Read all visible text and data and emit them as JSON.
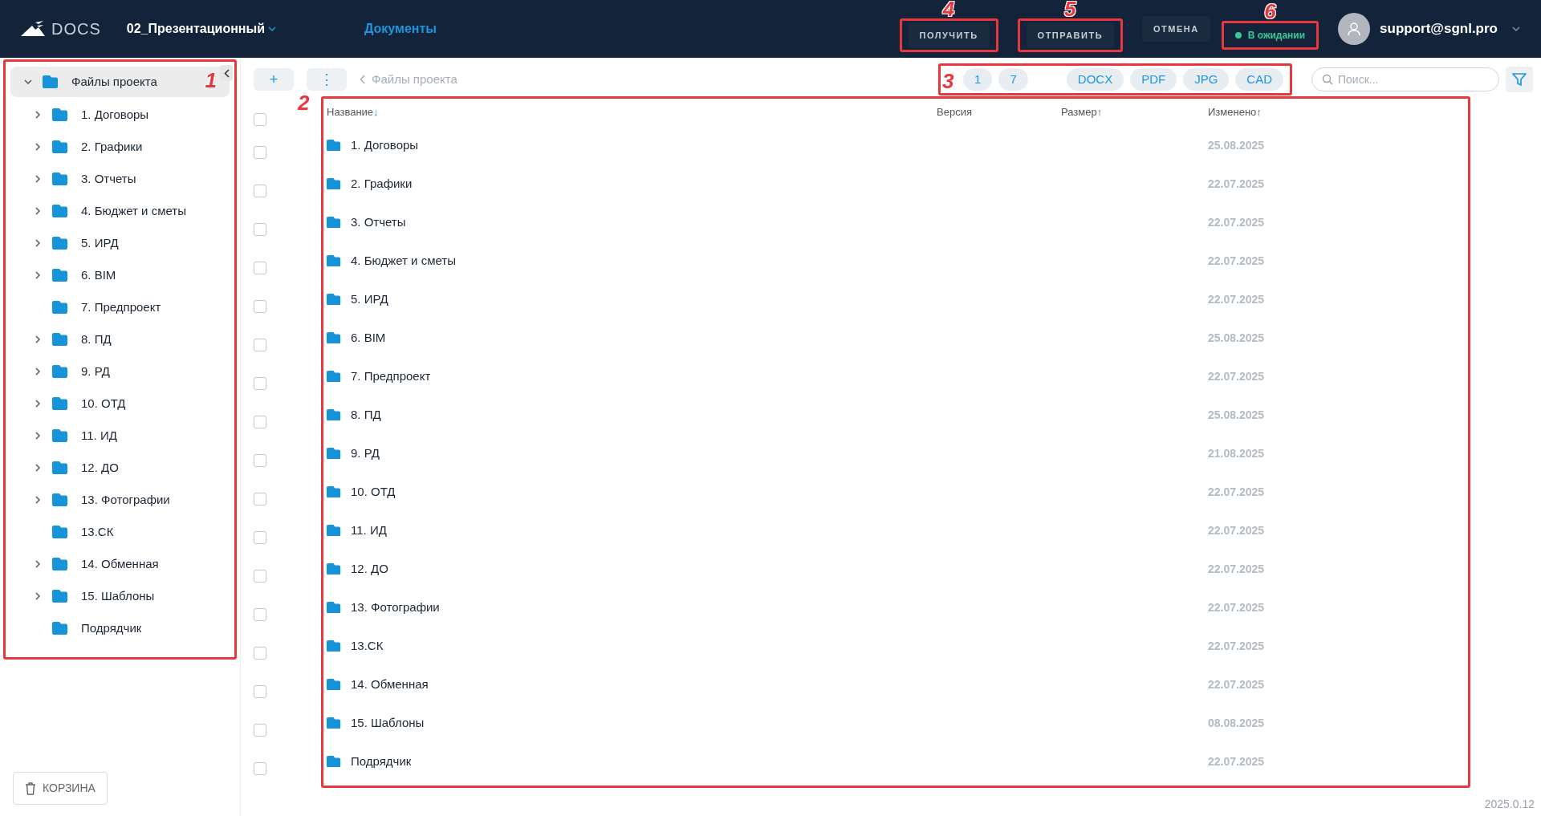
{
  "topbar": {
    "logo": "DOCS",
    "project": "02_Презентационный",
    "nav_link": "Документы",
    "actions": [
      {
        "label": "ПОЛУЧИТЬ",
        "annotation": "4"
      },
      {
        "label": "ОТПРАВИТЬ",
        "annotation": "5"
      },
      {
        "label": "ОТМЕНА"
      }
    ],
    "status": {
      "label": "В ожидании",
      "color": "#3cc79a",
      "annotation": "6"
    },
    "user": "support@sgnl.pro"
  },
  "sidebar": {
    "annotation": "1",
    "tree": {
      "label": "Файлы проекта",
      "selected": true,
      "expanded": true,
      "children": [
        {
          "label": "1. Договоры",
          "expandable": true
        },
        {
          "label": "2. Графики",
          "expandable": true
        },
        {
          "label": "3. Отчеты",
          "expandable": true
        },
        {
          "label": "4. Бюджет и сметы",
          "expandable": true
        },
        {
          "label": "5. ИРД",
          "expandable": true
        },
        {
          "label": "6. BIM",
          "expandable": true
        },
        {
          "label": "7. Предпроект",
          "expandable": false
        },
        {
          "label": "8. ПД",
          "expandable": true
        },
        {
          "label": "9. РД",
          "expandable": true
        },
        {
          "label": "10. ОТД",
          "expandable": true
        },
        {
          "label": "11. ИД",
          "expandable": true
        },
        {
          "label": "12. ДО",
          "expandable": true
        },
        {
          "label": "13. Фотографии",
          "expandable": true
        },
        {
          "label": "13.СК",
          "expandable": false
        },
        {
          "label": "14. Обменная",
          "expandable": true
        },
        {
          "label": "15. Шаблоны",
          "expandable": true
        },
        {
          "label": "Подрядчик",
          "expandable": false
        }
      ]
    },
    "trash": "КОРЗИНА"
  },
  "toolbar": {
    "add": "+",
    "more": "⋮",
    "breadcrumb": "Файлы проекта",
    "filters": {
      "annotation": "3",
      "items": [
        "1",
        "7",
        "DOCX",
        "PDF",
        "JPG",
        "CAD"
      ]
    },
    "search": {
      "placeholder": "Поиск..."
    }
  },
  "table": {
    "annotation": "2",
    "select_all": {
      "checked": false
    },
    "columns": [
      {
        "label": "Название",
        "sort_arrow": "↓",
        "sort_active": true
      },
      {
        "label": "Версия"
      },
      {
        "label": "Размер",
        "sort_arrow": "↑",
        "sort_active": false
      },
      {
        "label": "Изменено",
        "sort_arrow": "↑",
        "sort_active": false
      }
    ],
    "rows": [
      {
        "name": "1. Договоры",
        "modified": "25.08.2025",
        "checked": false
      },
      {
        "name": "2. Графики",
        "modified": "22.07.2025",
        "checked": false
      },
      {
        "name": "3. Отчеты",
        "modified": "22.07.2025",
        "checked": false
      },
      {
        "name": "4. Бюджет и сметы",
        "modified": "22.07.2025",
        "checked": false
      },
      {
        "name": "5. ИРД",
        "modified": "22.07.2025",
        "checked": false
      },
      {
        "name": "6. BIM",
        "modified": "25.08.2025",
        "checked": false
      },
      {
        "name": "7. Предпроект",
        "modified": "22.07.2025",
        "checked": false
      },
      {
        "name": "8. ПД",
        "modified": "25.08.2025",
        "checked": false
      },
      {
        "name": "9. РД",
        "modified": "21.08.2025",
        "checked": false
      },
      {
        "name": "10. ОТД",
        "modified": "22.07.2025",
        "checked": false
      },
      {
        "name": "11. ИД",
        "modified": "22.07.2025",
        "checked": false
      },
      {
        "name": "12. ДО",
        "modified": "22.07.2025",
        "checked": false
      },
      {
        "name": "13. Фотографии",
        "modified": "22.07.2025",
        "checked": false
      },
      {
        "name": "13.СК",
        "modified": "22.07.2025",
        "checked": false
      },
      {
        "name": "14. Обменная",
        "modified": "22.07.2025",
        "checked": false
      },
      {
        "name": "15. Шаблоны",
        "modified": "08.08.2025",
        "checked": false
      },
      {
        "name": "Подрядчик",
        "modified": "22.07.2025",
        "checked": false
      }
    ]
  },
  "version": "2025.0.12"
}
